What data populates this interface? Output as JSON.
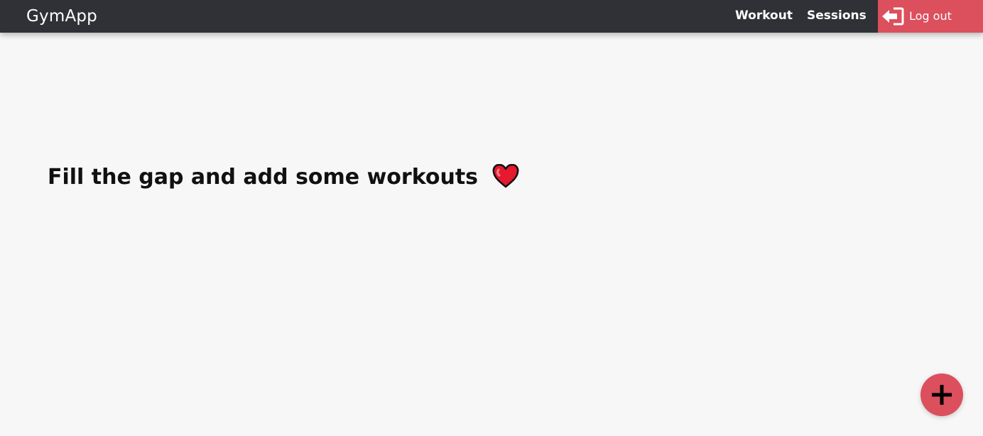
{
  "navbar": {
    "brand": "GymApp",
    "links": [
      {
        "label": "Workout"
      },
      {
        "label": "Sessions"
      }
    ],
    "logout": {
      "label": "Log out",
      "icon": "logout-icon",
      "background_color": "#dc4f5d"
    },
    "background_color": "#2f3136"
  },
  "main": {
    "empty_message": "Fill the gap and add some workouts",
    "message_icon": "heart-icon"
  },
  "floating_action_button": {
    "icon": "plus-icon",
    "background_color": "#dc4f5d"
  }
}
